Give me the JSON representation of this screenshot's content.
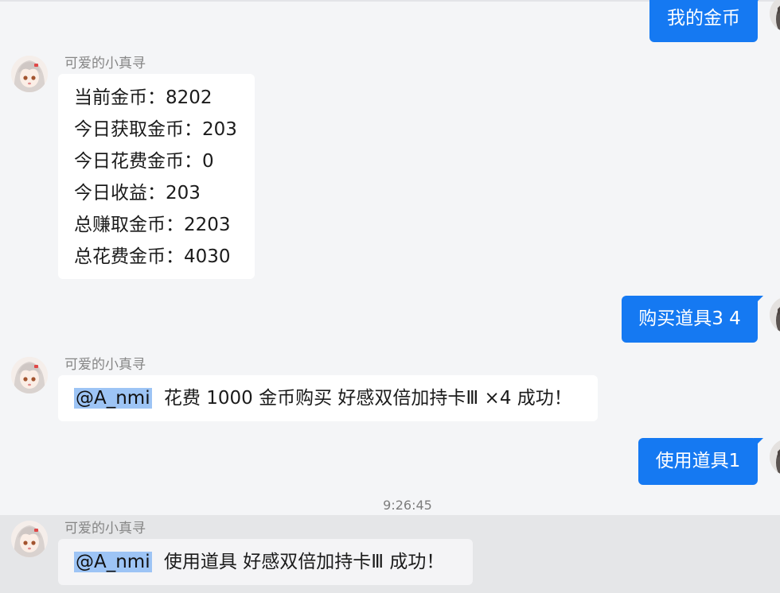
{
  "chat": {
    "sender_name": "可爱的小真寻",
    "timestamp": "9:26:45",
    "msg_out_1": "我的金币",
    "stats_lines": [
      "当前金币：8202",
      "今日获取金币：203",
      "今日花费金币：0",
      "今日收益：203",
      "总赚取金币：2203",
      "总花费金币：4030"
    ],
    "msg_out_2": "购买道具3 4",
    "reply_2": {
      "mention": "@A_nmi",
      "text": "花费 1000 金币购买 好感双倍加持卡Ⅲ ×4 成功！"
    },
    "msg_out_3": "使用道具1",
    "reply_3": {
      "mention": "@A_nmi",
      "text": "使用道具 好感双倍加持卡Ⅲ 成功！"
    }
  },
  "colors": {
    "background": "#f4f5f7",
    "outgoing_bubble": "#1579f2",
    "incoming_bubble": "#ffffff",
    "mention_highlight": "#9dc4f5",
    "hover_row": "#e5e6e8"
  },
  "icons": {
    "bot_avatar": "anime-girl-avatar",
    "self_avatar": "user-avatar"
  }
}
